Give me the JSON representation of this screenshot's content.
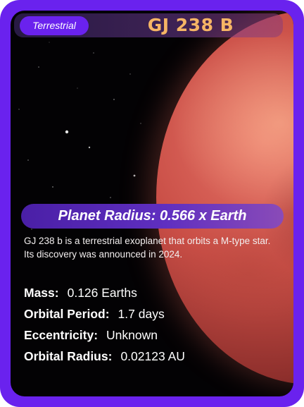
{
  "card": {
    "type_badge": "Terrestrial",
    "planet_name": "GJ 238 B",
    "radius_label": "Planet Radius: 0.566 x Earth",
    "description": "GJ 238 b is a terrestrial exoplanet that orbits a M-type star. Its discovery was announced in 2024.",
    "stats": [
      {
        "label": "Mass:",
        "value": "0.126 Earths"
      },
      {
        "label": "Orbital Period:",
        "value": "1.7 days"
      },
      {
        "label": "Eccentricity:",
        "value": "Unknown"
      },
      {
        "label": "Orbital Radius:",
        "value": "0.02123 AU"
      }
    ]
  },
  "colors": {
    "frame": "#6a22ee",
    "title": "#f6b565",
    "background": "#030204",
    "planet": "#c94e46"
  }
}
